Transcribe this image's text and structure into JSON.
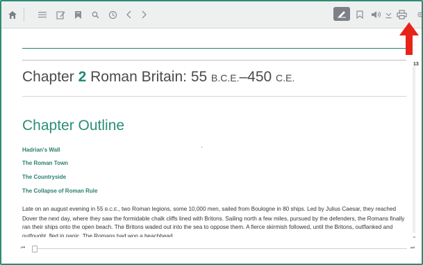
{
  "toolbar": {
    "icons": [
      "home-icon",
      "list-icon",
      "notes-icon",
      "bookmarks-icon",
      "search-icon",
      "history-icon",
      "prev-icon",
      "next-icon",
      "highlighter-icon",
      "bookmark-icon",
      "audio-icon",
      "download-icon",
      "print-icon",
      "settings-icon"
    ]
  },
  "document": {
    "page_number": "13",
    "chapter_word": "Chapter",
    "chapter_num": "2",
    "chapter_title_a": "Roman Britain: 55 ",
    "chapter_bce": "B.C.E.",
    "chapter_dash": "–450 ",
    "chapter_ce": "C.E.",
    "outline_title": "Chapter Outline",
    "outline_items": [
      "Hadrian's Wall",
      "The Roman Town",
      "The Countryside",
      "The Collapse of Roman Rule"
    ],
    "body_p1": "Late on an august evening in 55 ",
    "body_p1_sc": "B.C.E.",
    "body_p2": ", two Roman legions, some 10,000 men, sailed from Boulogne in 80 ships. Led by Julius Caesar, they reached Dover the next day, where they saw the formidable chalk cliffs lined with Britons. Sailing north a few miles, pursued by the defenders, the Romans finally ran their ships onto the open beach. The Britons waded out into the sea to oppose them. A fierce skirmish followed, until the Britons, outflanked and outfought, fled in panic. The Romans had won a beachhead."
  },
  "colors": {
    "accent": "#1f8a73",
    "frame": "#2e8b74",
    "arrow": "#e8231a"
  }
}
